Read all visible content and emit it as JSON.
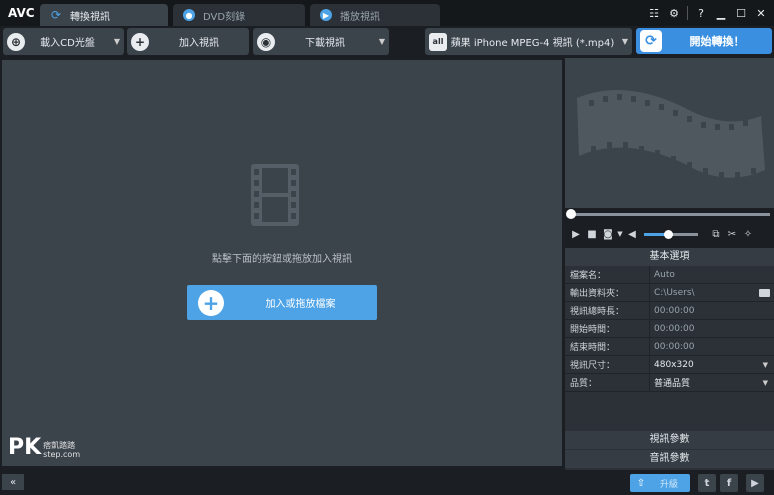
{
  "app": {
    "logo": "AVC"
  },
  "tabs": [
    {
      "label": "轉換視訊",
      "icon": "refresh-icon"
    },
    {
      "label": "DVD刻錄",
      "icon": "disc-icon"
    },
    {
      "label": "播放視訊",
      "icon": "play-icon"
    }
  ],
  "toolbar": {
    "load_cd": "載入CD光盤",
    "add_video": "加入視訊",
    "download_video": "下載視訊",
    "format": "蘋果 iPhone MPEG-4 視訊 (*.mp4)",
    "convert": "開始轉換！"
  },
  "main": {
    "hint": "點擊下面的按鈕或拖放加入視訊",
    "add_file": "加入或拖放檔案"
  },
  "watermark": {
    "brand": "PK",
    "line1": "痞凱踏踏",
    "line2": "step.com"
  },
  "settings": {
    "basic_header": "基本選項",
    "rows": [
      {
        "key": "檔案名：",
        "value": "Auto"
      },
      {
        "key": "輸出資料夾：",
        "value": "C:\\Users\\"
      },
      {
        "key": "視訊總時長：",
        "value": "00:00:00"
      },
      {
        "key": "開始時間：",
        "value": "00:00:00"
      },
      {
        "key": "結束時間：",
        "value": "00:00:00"
      },
      {
        "key": "視訊尺寸：",
        "value": "480x320"
      },
      {
        "key": "品質：",
        "value": "普通品質"
      }
    ],
    "video_params": "視訊參數",
    "audio_params": "音訊參數"
  },
  "player": {
    "volume_level": 0.45,
    "seek_position": 0.0
  },
  "bottom": {
    "upgrade": "升級"
  },
  "colors": {
    "accent": "#4ea3e6",
    "convert": "#3a8fe0",
    "panel": "#3b434b",
    "bg": "#1b1f23"
  }
}
